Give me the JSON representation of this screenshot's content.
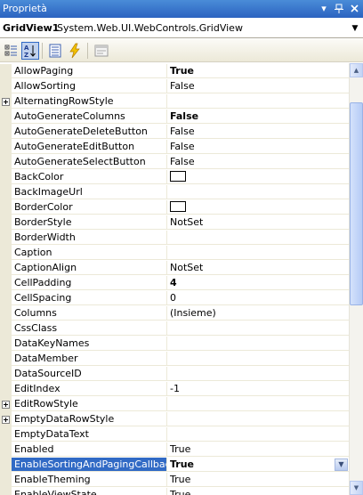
{
  "window": {
    "title": "Proprietà",
    "pin_glyph": "⊓",
    "pin_icon": "pin-icon",
    "close_glyph": "×",
    "close_icon": "close-icon",
    "menu_glyph": "▾"
  },
  "selector": {
    "object_name": "GridView1",
    "object_type": "System.Web.UI.WebControls.GridView",
    "dropdown_glyph": "▼"
  },
  "toolbar": {
    "buttons": [
      {
        "icon": "categorized-icon"
      },
      {
        "icon": "alphabetical-icon",
        "active": true
      },
      {
        "icon": "properties-icon"
      },
      {
        "icon": "events-icon"
      },
      {
        "icon": "property-pages-icon"
      }
    ]
  },
  "colors": {
    "selection": "#316ac5",
    "gutter": "#ece9d8",
    "title_bar": "#2b63c0"
  },
  "properties": [
    {
      "name": "AllowPaging",
      "value": "True",
      "bold": true
    },
    {
      "name": "AllowSorting",
      "value": "False"
    },
    {
      "name": "AlternatingRowStyle",
      "value": "",
      "expandable": true
    },
    {
      "name": "AutoGenerateColumns",
      "value": "False",
      "bold": true
    },
    {
      "name": "AutoGenerateDeleteButton",
      "value": "False"
    },
    {
      "name": "AutoGenerateEditButton",
      "value": "False"
    },
    {
      "name": "AutoGenerateSelectButton",
      "value": "False"
    },
    {
      "name": "BackColor",
      "value": "",
      "swatch": true
    },
    {
      "name": "BackImageUrl",
      "value": ""
    },
    {
      "name": "BorderColor",
      "value": "",
      "swatch": true
    },
    {
      "name": "BorderStyle",
      "value": "NotSet"
    },
    {
      "name": "BorderWidth",
      "value": ""
    },
    {
      "name": "Caption",
      "value": ""
    },
    {
      "name": "CaptionAlign",
      "value": "NotSet"
    },
    {
      "name": "CellPadding",
      "value": "4",
      "bold": true
    },
    {
      "name": "CellSpacing",
      "value": "0"
    },
    {
      "name": "Columns",
      "value": "(Insieme)"
    },
    {
      "name": "CssClass",
      "value": ""
    },
    {
      "name": "DataKeyNames",
      "value": ""
    },
    {
      "name": "DataMember",
      "value": ""
    },
    {
      "name": "DataSourceID",
      "value": ""
    },
    {
      "name": "EditIndex",
      "value": "-1"
    },
    {
      "name": "EditRowStyle",
      "value": "",
      "expandable": true
    },
    {
      "name": "EmptyDataRowStyle",
      "value": "",
      "expandable": true
    },
    {
      "name": "EmptyDataText",
      "value": ""
    },
    {
      "name": "Enabled",
      "value": "True"
    },
    {
      "name": "EnableSortingAndPagingCallbacks",
      "value": "True",
      "bold": true,
      "selected": true
    },
    {
      "name": "EnableTheming",
      "value": "True"
    },
    {
      "name": "EnableViewState",
      "value": "True"
    }
  ]
}
